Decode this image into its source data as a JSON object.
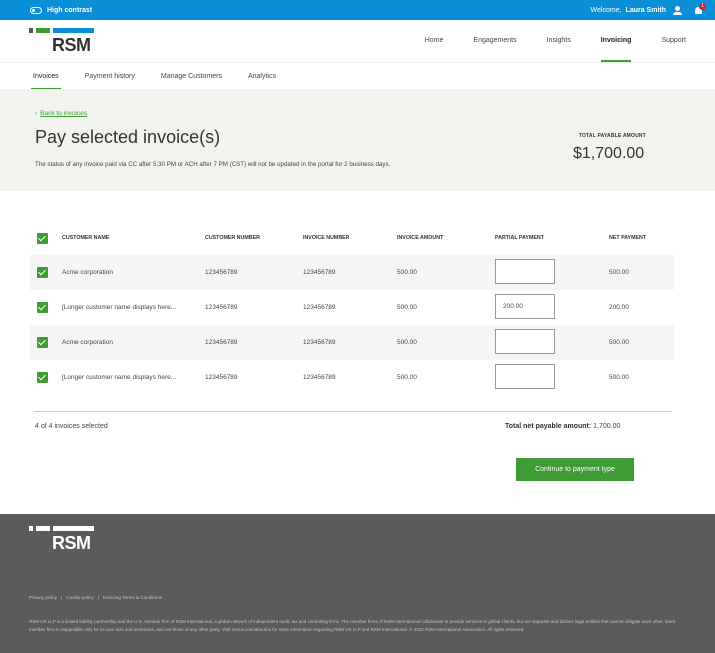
{
  "topbar": {
    "high_contrast_label": "High contrast",
    "welcome_label": "Welcome,",
    "user_name": "Laura Smith",
    "notification_count": "1"
  },
  "brand": {
    "logo_text": "RSM"
  },
  "nav": {
    "items": [
      {
        "label": "Home"
      },
      {
        "label": "Engagements"
      },
      {
        "label": "Insights"
      },
      {
        "label": "Invoicing",
        "active": true
      },
      {
        "label": "Support"
      }
    ]
  },
  "subnav": {
    "items": [
      {
        "label": "Invoices",
        "active": true
      },
      {
        "label": "Payment history"
      },
      {
        "label": "Manage Customers"
      },
      {
        "label": "Analytics"
      }
    ]
  },
  "banner": {
    "back_link": "Back to invoices",
    "title": "Pay selected invoice(s)",
    "notice": "The status of any invoice paid via CC after 5:30 PM or ACH after 7 PM (CST) will not be updated in the portal for 2 business days.",
    "total_label": "TOTAL PAYABLE AMOUNT",
    "total_amount": "$1,700.00"
  },
  "table": {
    "headers": {
      "customer_name": "CUSTOMER NAME",
      "customer_number": "CUSTOMER NUMBER",
      "invoice_number": "INVOICE NUMBER",
      "invoice_amount": "INVOICE AMOUNT",
      "partial_payment": "PARTIAL PAYMENT",
      "net_payment": "NET PAYMENT"
    },
    "rows": [
      {
        "customer_name": "Acme corporation",
        "customer_number": "123456789",
        "invoice_number": "123456789",
        "invoice_amount": "500.00",
        "partial_payment": "",
        "net_payment": "500.00",
        "checked": true
      },
      {
        "customer_name": "[Longer customer name displays here...",
        "customer_number": "123456789",
        "invoice_number": "123456789",
        "invoice_amount": "500.00",
        "partial_payment": "200.00",
        "net_payment": "200.00",
        "checked": true
      },
      {
        "customer_name": "Acme corporation",
        "customer_number": "123456789",
        "invoice_number": "123456789",
        "invoice_amount": "500.00",
        "partial_payment": "",
        "net_payment": "500.00",
        "checked": true
      },
      {
        "customer_name": "[Longer customer name displays here...",
        "customer_number": "123456789",
        "invoice_number": "123456789",
        "invoice_amount": "500.00",
        "partial_payment": "",
        "net_payment": "500.00",
        "checked": true
      }
    ]
  },
  "summary": {
    "selected_count": "4 of 4 invoices selected",
    "net_label": "Total net payable amount:",
    "net_amount": "1,700.00",
    "continue_label": "Continue to payment type"
  },
  "footer": {
    "logo_text": "RSM",
    "links": [
      "Privacy policy",
      "Cookie policy",
      "Invoicing Terms & Conditions"
    ],
    "legal": "RSM US LLP is a limited liability partnership and the U.S. member firm of RSM International, a global network of independent audit, tax and consulting firms. The member firms of RSM International collaborate to provide services to global clients, but are separate and distinct legal entities that cannot obligate each other. Each member firm is responsible only for its own acts and omissions, and not those of any other party. Visit rsmus.com/aboutus for more information regarding RSM US LLP and RSM International. © 2022 RSM International Association. All rights reserved."
  },
  "colors": {
    "topbar": "#0a8fd6",
    "accent_green": "#3f9c35",
    "footer": "#5a5b5d",
    "banner": "#f2f2ef"
  }
}
